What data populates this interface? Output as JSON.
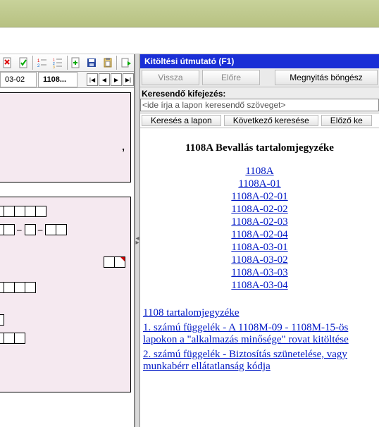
{
  "top": {},
  "toolbar": {
    "icons": [
      "page-red-x",
      "page-green-check",
      "tree-12",
      "tree-123",
      "page-plus",
      "save",
      "paste",
      "export-icon"
    ]
  },
  "tabs": {
    "tab1": "03-02",
    "tab2": "1108...",
    "nav": {
      "first": "|◀",
      "prev": "◀",
      "next": "▶",
      "last": "▶|"
    }
  },
  "form": {
    "pink1_line1": "",
    "pink1_line2": ","
  },
  "help": {
    "header": "Kitöltési útmutató (F1)",
    "back": "Vissza",
    "forward": "Előre",
    "open_browser": "Megnyitás böngész",
    "search_label": "Keresendő kifejezés:",
    "search_placeholder": "<ide írja a lapon keresendő szöveget>",
    "btn_search_page": "Keresés a lapon",
    "btn_search_next": "Következő keresése",
    "btn_search_prev": "Előző ke",
    "title": "1108A Bevallás tartalomjegyzéke",
    "toc": [
      "1108A",
      "1108A-01",
      "1108A-02-01",
      "1108A-02-02",
      "1108A-02-03",
      "1108A-02-04",
      "1108A-03-01",
      "1108A-03-02",
      "1108A-03-03",
      "1108A-03-04"
    ],
    "link_main_toc": "1108 tartalomjegyzéke",
    "appendix1": "1. számú függelék - A 1108M-09 - 1108M-15-ös lapokon a \"alkalmazás minősége\" rovat kitöltése",
    "appendix2": "2. számú függelék - Biztosítás szünetelése, vagy munkabérr ellátatlanság kódja"
  }
}
